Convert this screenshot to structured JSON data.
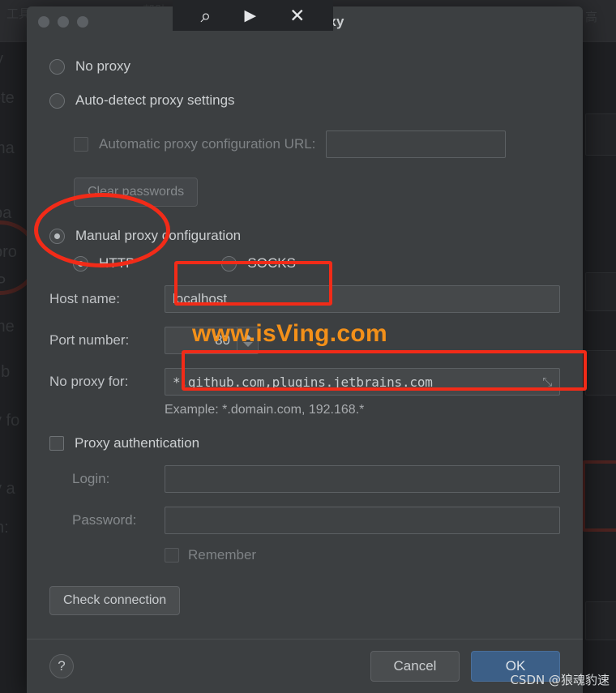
{
  "window": {
    "title": "HTTP Proxy",
    "traffic_lights": [
      "close",
      "minimize",
      "maximize"
    ]
  },
  "overlay_toolbar": {
    "icons": [
      {
        "name": "search-icon",
        "glyph": "⌕"
      },
      {
        "name": "play-icon",
        "glyph": "▶"
      },
      {
        "name": "close-icon",
        "glyph": "✕"
      }
    ]
  },
  "form": {
    "no_proxy": {
      "label": "No proxy",
      "checked": false
    },
    "auto_detect": {
      "label": "Auto-detect proxy settings",
      "checked": false
    },
    "auto_config_url": {
      "label": "Automatic proxy configuration URL:",
      "checked": false,
      "enabled": false,
      "value": ""
    },
    "clear_passwords": {
      "label": "Clear passwords",
      "enabled": false
    },
    "manual": {
      "label": "Manual proxy configuration",
      "checked": true
    },
    "protocol": {
      "http": {
        "label": "HTTP",
        "checked": true
      },
      "socks": {
        "label": "SOCKS",
        "checked": false
      }
    },
    "host_name": {
      "label": "Host name:",
      "value": "localhost"
    },
    "port_number": {
      "label": "Port number:",
      "value": "80"
    },
    "no_proxy_for": {
      "label": "No proxy for:",
      "value": "*.github.com,plugins.jetbrains.com",
      "expand_icon": "⤡",
      "example": "Example: *.domain.com, 192.168.*"
    },
    "proxy_auth": {
      "label": "Proxy authentication",
      "checked": false
    },
    "login": {
      "label": "Login:",
      "value": ""
    },
    "password": {
      "label": "Password:",
      "value": ""
    },
    "remember": {
      "label": "Remember",
      "checked": false
    },
    "check_connection": {
      "label": "Check connection"
    }
  },
  "footer": {
    "help": "?",
    "cancel": "Cancel",
    "ok": "OK"
  },
  "watermarks": {
    "orange": "www.isVing.com",
    "csdn": "CSDN @狼魂豹速"
  },
  "colors": {
    "dialog_bg": "#3c3f41",
    "accent_ok": "#3c5f87",
    "annotation_red": "#f22b18",
    "watermark_orange": "#f39019"
  }
}
